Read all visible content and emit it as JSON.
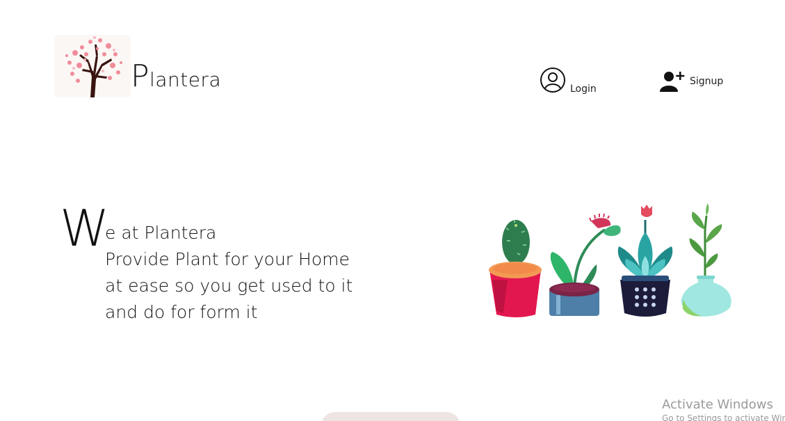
{
  "header": {
    "brand_initial": "P",
    "brand_rest": "lantera",
    "nav": {
      "login_label": "Login",
      "signup_label": "Signup"
    }
  },
  "hero": {
    "dropcap": "W",
    "line1": "e at Plantera",
    "line2": "Provide Plant for your Home",
    "line3": "at ease so you get used to it",
    "line4": "and do for form it"
  },
  "icons": {
    "logo": "tree-logo-icon",
    "login": "user-circle-icon",
    "signup": "user-plus-icon",
    "illustration": "potted-plants-illustration"
  },
  "colors": {
    "pot_red": "#e3174f",
    "pot_orange": "#f28b4a",
    "cactus_green": "#2e8b57",
    "teal": "#1f8a8a",
    "mint": "#9fe7e0",
    "navy": "#1c1b3a",
    "bottom_button": "#efe4e4"
  },
  "watermark": {
    "title": "Activate Windows",
    "subtitle": "Go to Settings to activate Windows."
  }
}
